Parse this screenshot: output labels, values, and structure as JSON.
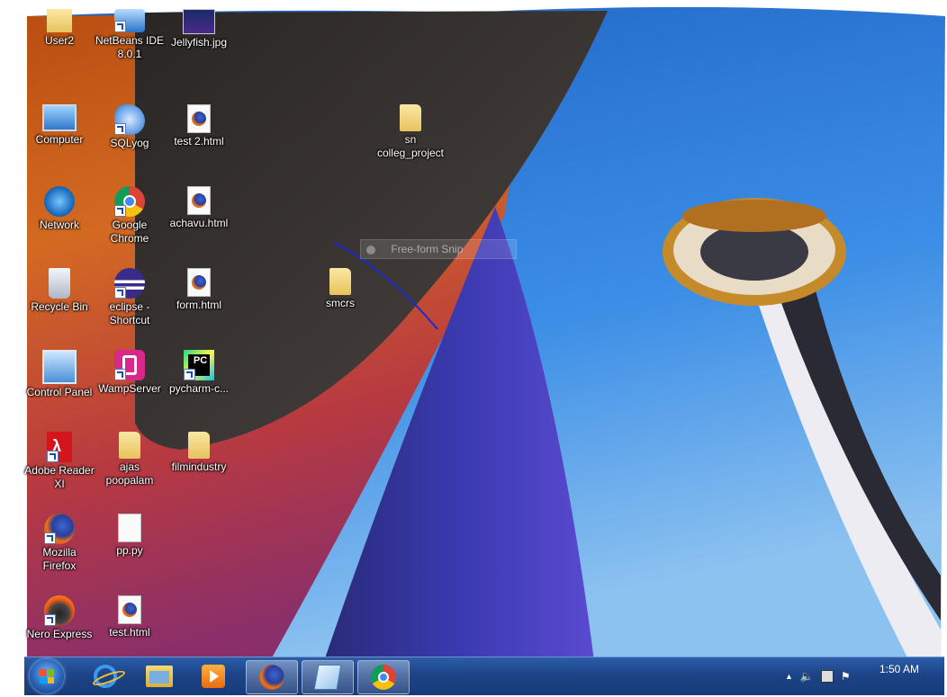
{
  "desktop": {
    "icons": [
      {
        "label": "User2",
        "icon": "user-folder-icon"
      },
      {
        "label": "NetBeans IDE\n8.0.1",
        "icon": "netbeans-icon"
      },
      {
        "label": "Jellyfish.jpg",
        "icon": "image-file-icon"
      },
      {
        "label": "Computer",
        "icon": "computer-icon"
      },
      {
        "label": "SQLyog",
        "icon": "sqlyog-icon"
      },
      {
        "label": "test 2.html",
        "icon": "firefox-html-file-icon"
      },
      {
        "label": "sn\ncolleg_project",
        "icon": "folder-icon"
      },
      {
        "label": "Network",
        "icon": "network-icon"
      },
      {
        "label": "Google\nChrome",
        "icon": "chrome-icon"
      },
      {
        "label": "achavu.html",
        "icon": "firefox-html-file-icon"
      },
      {
        "label": "Recycle Bin",
        "icon": "recycle-bin-icon"
      },
      {
        "label": "eclipse -\nShortcut",
        "icon": "eclipse-icon"
      },
      {
        "label": "form.html",
        "icon": "firefox-html-file-icon"
      },
      {
        "label": "smcrs",
        "icon": "folder-icon"
      },
      {
        "label": "Control Panel",
        "icon": "control-panel-icon"
      },
      {
        "label": "WampServer",
        "icon": "wampserver-icon"
      },
      {
        "label": "pycharm-c...",
        "icon": "pycharm-icon"
      },
      {
        "label": "Adobe Reader\nXI",
        "icon": "adobe-reader-icon"
      },
      {
        "label": "ajas\npoopalam",
        "icon": "folder-icon"
      },
      {
        "label": "filmindustry",
        "icon": "folder-icon"
      },
      {
        "label": "Mozilla\nFirefox",
        "icon": "firefox-icon"
      },
      {
        "label": "pp.py",
        "icon": "blank-file-icon"
      },
      {
        "label": "Nero Express",
        "icon": "nero-icon"
      },
      {
        "label": "test.html",
        "icon": "firefox-html-file-icon"
      }
    ]
  },
  "snip_toolbar": {
    "label": "Free-form Snip"
  },
  "taskbar": {
    "items": [
      {
        "name": "internet-explorer",
        "icon": "internet-explorer-icon"
      },
      {
        "name": "windows-explorer",
        "icon": "windows-explorer-icon"
      },
      {
        "name": "media-player",
        "icon": "media-player-icon"
      },
      {
        "name": "firefox",
        "icon": "firefox-icon"
      },
      {
        "name": "snipping-tool",
        "icon": "snipping-tool-icon"
      },
      {
        "name": "chrome",
        "icon": "chrome-icon"
      }
    ],
    "clock": "1:50 AM"
  },
  "colors": {
    "sky": "#2e7ad6",
    "taskbar": "#1d4488",
    "building_dark": "#3a3433",
    "building_orange": "#c55a1a"
  }
}
